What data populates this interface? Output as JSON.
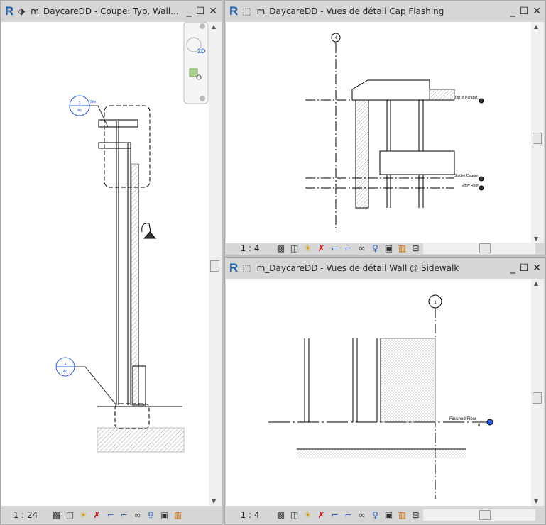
{
  "windows": [
    {
      "title": "m_DaycareDD - Coupe: Typ. Wall...",
      "scale": "1 : 24",
      "view_type": "section"
    },
    {
      "title": "m_DaycareDD - Vues de détail Cap Flashing",
      "scale": "1 : 4",
      "view_type": "detail"
    },
    {
      "title": "m_DaycareDD - Vues de détail Wall @ Sidewalk",
      "scale": "1 : 4",
      "view_type": "detail"
    }
  ],
  "app_icon": "R",
  "nav_bar": {
    "badge": "2D"
  },
  "annotations": {
    "left": {
      "callout1_num": "1",
      "callout1_sheet": "A5",
      "callout1_label": "Sim",
      "callout2_num": "4",
      "callout2_sheet": "A5"
    },
    "cap": {
      "grid": "4",
      "levels": [
        "Top of Parapet",
        "Soldier Course",
        "Entry Roof"
      ]
    },
    "sidewalk": {
      "grid": "1",
      "level": "Finished Floor",
      "level_value": "0"
    }
  },
  "status_icons": [
    "detail-level-icon",
    "visual-style-icon",
    "sun-path-icon",
    "shadows-icon",
    "crop-view-icon",
    "show-crop-icon",
    "temporary-hide-icon",
    "reveal-hidden-icon",
    "temporary-view-properties-icon",
    "analytical-model-icon",
    "lock-3d-icon"
  ]
}
